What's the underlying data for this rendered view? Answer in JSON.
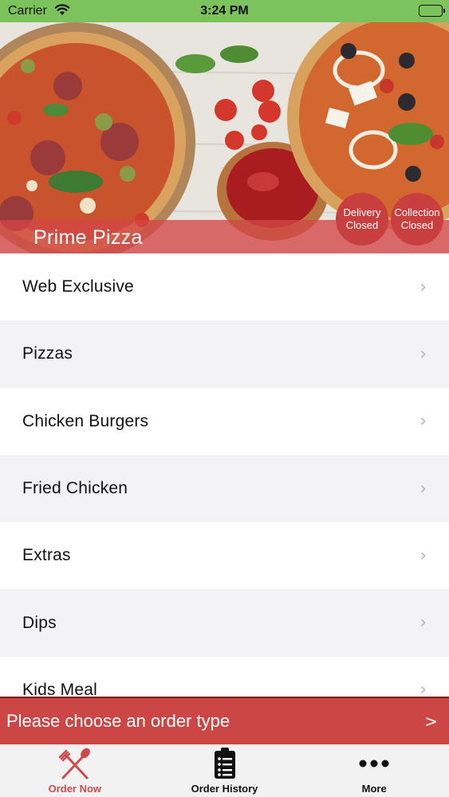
{
  "status_bar": {
    "carrier": "Carrier",
    "time": "3:24 PM",
    "wifi_icon": "wifi-icon",
    "battery_icon": "battery-icon",
    "background_color": "#7cc35e"
  },
  "hero": {
    "restaurant_name": "Prime Pizza",
    "delivery_status": [
      "Delivery",
      "Closed"
    ],
    "collection_status": [
      "Collection",
      "Closed"
    ],
    "accent_color": "#c93e3e"
  },
  "menu": {
    "items": [
      {
        "label": "Web Exclusive"
      },
      {
        "label": "Pizzas"
      },
      {
        "label": "Chicken Burgers"
      },
      {
        "label": "Fried Chicken"
      },
      {
        "label": "Extras"
      },
      {
        "label": "Dips"
      },
      {
        "label": "Kids Meal"
      }
    ],
    "chevron": "›"
  },
  "order_banner": {
    "text": "Please choose an order type",
    "arrow": ">",
    "color": "#cc4646"
  },
  "tabs": [
    {
      "label": "Order Now",
      "icon": "fork-knife-icon",
      "active": true
    },
    {
      "label": "Order History",
      "icon": "clipboard-list-icon",
      "active": false
    },
    {
      "label": "More",
      "icon": "more-dots-icon",
      "active": false
    }
  ]
}
